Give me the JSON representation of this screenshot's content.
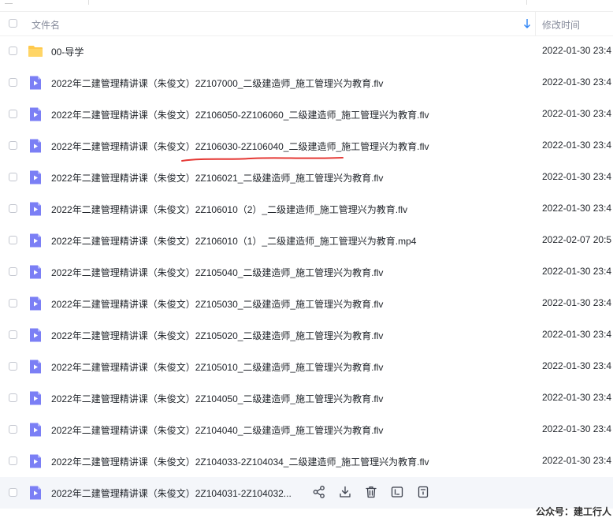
{
  "header": {
    "name_label": "文件名",
    "time_label": "修改时间"
  },
  "rows": [
    {
      "type": "folder",
      "name": "00-导学",
      "time": "2022-01-30 23:4"
    },
    {
      "type": "video",
      "name": "2022年二建管理精讲课（朱俊文）2Z107000_二级建造师_施工管理兴为教育.flv",
      "time": "2022-01-30 23:4"
    },
    {
      "type": "video",
      "name": "2022年二建管理精讲课（朱俊文）2Z106050-2Z106060_二级建造师_施工管理兴为教育.flv",
      "time": "2022-01-30 23:4"
    },
    {
      "type": "video",
      "name": "2022年二建管理精讲课（朱俊文）2Z106030-2Z106040_二级建造师_施工管理兴为教育.flv",
      "time": "2022-01-30 23:4"
    },
    {
      "type": "video",
      "name": "2022年二建管理精讲课（朱俊文）2Z106021_二级建造师_施工管理兴为教育.flv",
      "time": "2022-01-30 23:4"
    },
    {
      "type": "video",
      "name": "2022年二建管理精讲课（朱俊文）2Z106010（2）_二级建造师_施工管理兴为教育.flv",
      "time": "2022-01-30 23:4"
    },
    {
      "type": "video",
      "name": "2022年二建管理精讲课（朱俊文）2Z106010（1）_二级建造师_施工管理兴为教育.mp4",
      "time": "2022-02-07 20:5"
    },
    {
      "type": "video",
      "name": "2022年二建管理精讲课（朱俊文）2Z105040_二级建造师_施工管理兴为教育.flv",
      "time": "2022-01-30 23:4"
    },
    {
      "type": "video",
      "name": "2022年二建管理精讲课（朱俊文）2Z105030_二级建造师_施工管理兴为教育.flv",
      "time": "2022-01-30 23:4"
    },
    {
      "type": "video",
      "name": "2022年二建管理精讲课（朱俊文）2Z105020_二级建造师_施工管理兴为教育.flv",
      "time": "2022-01-30 23:4"
    },
    {
      "type": "video",
      "name": "2022年二建管理精讲课（朱俊文）2Z105010_二级建造师_施工管理兴为教育.flv",
      "time": "2022-01-30 23:4"
    },
    {
      "type": "video",
      "name": "2022年二建管理精讲课（朱俊文）2Z104050_二级建造师_施工管理兴为教育.flv",
      "time": "2022-01-30 23:4"
    },
    {
      "type": "video",
      "name": "2022年二建管理精讲课（朱俊文）2Z104040_二级建造师_施工管理兴为教育.flv",
      "time": "2022-01-30 23:4"
    },
    {
      "type": "video",
      "name": "2022年二建管理精讲课（朱俊文）2Z104033-2Z104034_二级建造师_施工管理兴为教育.flv",
      "time": "2022-01-30 23:4"
    },
    {
      "type": "video",
      "name": "2022年二建管理精讲课（朱俊文）2Z104031-2Z104032...",
      "time": "",
      "hover": true
    }
  ],
  "hover_actions": [
    "share-icon",
    "download-icon",
    "delete-icon",
    "rename-icon",
    "more-icon"
  ],
  "watermark": "公众号：建工行人",
  "colors": {
    "folder": "#ffc94d",
    "video": "#7b7ff5",
    "accent": "#2b83f6",
    "annotation": "#e53935"
  }
}
